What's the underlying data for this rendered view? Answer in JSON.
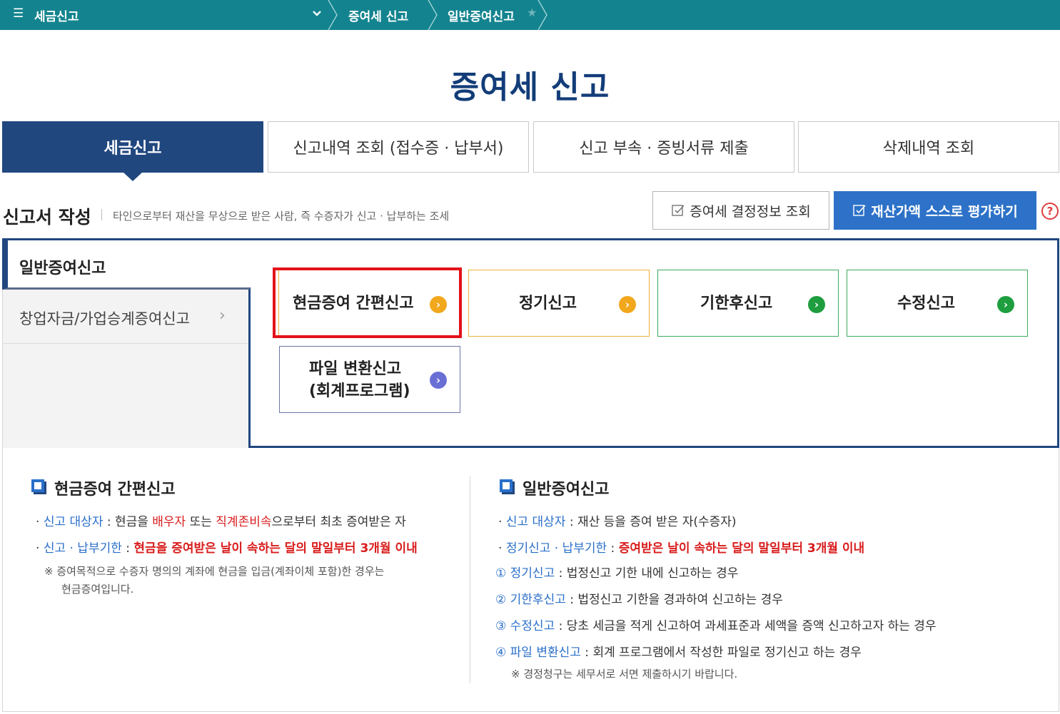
{
  "topnav": {
    "menu_icon": "☰",
    "title": "세금신고",
    "crumbs": [
      "증여세 신고",
      "일반증여신고"
    ],
    "star": "★"
  },
  "page": {
    "title": "증여세 신고"
  },
  "tabs": [
    {
      "label": "세금신고"
    },
    {
      "label": "신고내역 조회 (접수증 · 납부서)"
    },
    {
      "label": "신고 부속 · 증빙서류 제출"
    },
    {
      "label": "삭제내역 조회"
    }
  ],
  "section": {
    "title": "신고서 작성",
    "desc": "타인으로부터 재산을 무상으로 받은 사람, 즉 수증자가 신고 · 납부하는 조세",
    "btn_lookup": "증여세 결정정보 조회",
    "btn_evaluate": "재산가액 스스로 평가하기",
    "help": "?"
  },
  "side": {
    "active": "일반증여신고",
    "item2": "창업자금/가업승계증여신고",
    "arrow": "›"
  },
  "cards": [
    {
      "label": "현금증여 간편신고",
      "icon": "›"
    },
    {
      "label": "정기신고",
      "icon": "›"
    },
    {
      "label": "기한후신고",
      "icon": "›"
    },
    {
      "label": "수정신고",
      "icon": "›"
    },
    {
      "label1": "파일 변환신고",
      "label2": "(회계프로그램)",
      "icon": "›"
    }
  ],
  "info_left": {
    "title": "현금증여 간편신고",
    "l1_key": "신고 대상자",
    "l1_a": " : 현금을 ",
    "l1_b": "배우자",
    "l1_c": " 또는 ",
    "l1_d": "직계존비속",
    "l1_e": "으로부터 최초 증여받은 자",
    "l2_key": "신고 · 납부기한",
    "l2_sep": " : ",
    "l2_val": "현금을 증여받은 날이 속하는 달의 말일부터 3개월 이내",
    "note1": "※ 증여목적으로 수증자 명의의 계좌에 현금을 입금(계좌이체 포함)한 경우는",
    "note2": "현금증여입니다."
  },
  "info_right": {
    "title": "일반증여신고",
    "l1_key": "신고 대상자",
    "l1_val": " : 재산 등을 증여 받은 자(수증자)",
    "l2_key": "정기신고 · 납부기한",
    "l2_sep": " : ",
    "l2_val": "증여받은 날이 속하는 달의 말일부터 3개월 이내",
    "items": [
      {
        "num": "①",
        "key": "정기신고",
        "val": " : 법정신고 기한 내에 신고하는 경우"
      },
      {
        "num": "②",
        "key": "기한후신고",
        "val": " : 법정신고 기한을 경과하여 신고하는 경우"
      },
      {
        "num": "③",
        "key": "수정신고",
        "val": " : 당초 세금을 적게 신고하여 과세표준과 세액을 증액 신고하고자 하는 경우"
      },
      {
        "num": "④",
        "key": "파일 변환신고",
        "val": " : 회계 프로그램에서 작성한 파일로 정기신고 하는 경우"
      }
    ],
    "note": "※ 경정청구는 세무서로 서면 제출하시기 바랍니다."
  },
  "colors": {
    "nav": "#13848f",
    "navy": "#21477f",
    "blue": "#2d72c8",
    "orange": "#f2a81d",
    "green": "#1e9e3e",
    "purple": "#6a6fd6",
    "red": "#e3121a"
  }
}
